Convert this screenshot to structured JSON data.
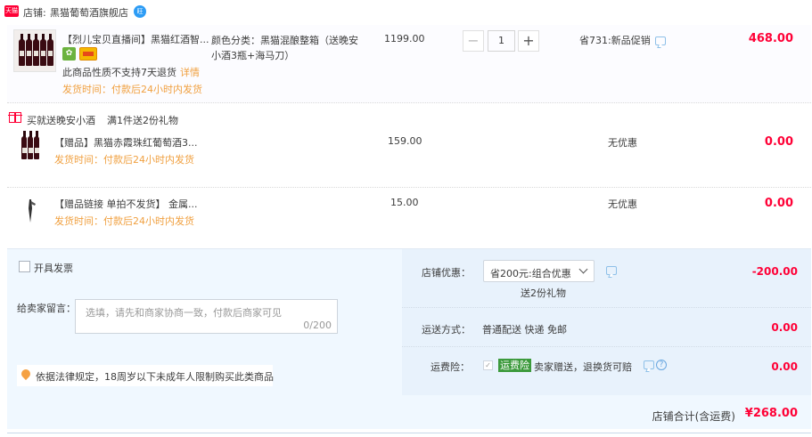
{
  "shop": {
    "badge": "天猫",
    "label": "店铺:",
    "name": "黑猫葡萄酒旗舰店",
    "ww": "旺"
  },
  "main_item": {
    "title": "【烈儿宝贝直播间】黑猫红酒智...",
    "badge_icon": "bulb-badge",
    "no_return": "此商品性质不支持7天退货",
    "detail_link": "详情",
    "ship_time": "发货时间：付款后24小时内发货",
    "sku": "颜色分类：黑猫混酿整箱（送晚安小酒3瓶+海马刀）",
    "price": "1199.00",
    "quantity": "1",
    "minus": "−",
    "plus": "+",
    "promo": "省731:新品促销",
    "amount": "468.00"
  },
  "gift_group": {
    "title": "买就送晚安小酒",
    "rule": "满1件送2份礼物"
  },
  "gifts": [
    {
      "name": "【赠品】黑猫赤霞珠红葡萄酒3...",
      "ship_time": "发货时间：付款后24小时内发货",
      "price": "159.00",
      "discount": "无优惠",
      "amount": "0.00"
    },
    {
      "name": "【赠品链接 单拍不发货】 金属...",
      "ship_time": "发货时间：付款后24小时内发货",
      "price": "15.00",
      "discount": "无优惠",
      "amount": "0.00"
    }
  ],
  "footer": {
    "invoice_label": "开具发票",
    "message_label": "给卖家留言：",
    "message_placeholder": "选填，请先和商家协商一致，付款后商家可见",
    "message_count": "0/200",
    "law_notice": "依据法律规定，18周岁以下未成年人限制购买此类商品"
  },
  "shop_discount": {
    "label": "店铺优惠：",
    "selected": "省200元:组合优惠",
    "gift_note": "送2份礼物",
    "amount": "-200.00"
  },
  "shipping": {
    "label": "运送方式：",
    "value": "普通配送 快递 免邮",
    "amount": "0.00"
  },
  "insurance": {
    "label": "运费险：",
    "check": "✓",
    "tag": "运费险",
    "desc": "卖家赠送，退换货可赔",
    "help": "?",
    "amount": "0.00"
  },
  "total": {
    "label": "店铺合计(含运费)",
    "value": "¥268.00"
  },
  "colors": {
    "accent": "#ff0036",
    "orange": "#f0a040",
    "panel_bg": "#e8f2fc",
    "footer_bg": "#f0f8ff",
    "link_blue": "#2d9cf5"
  }
}
